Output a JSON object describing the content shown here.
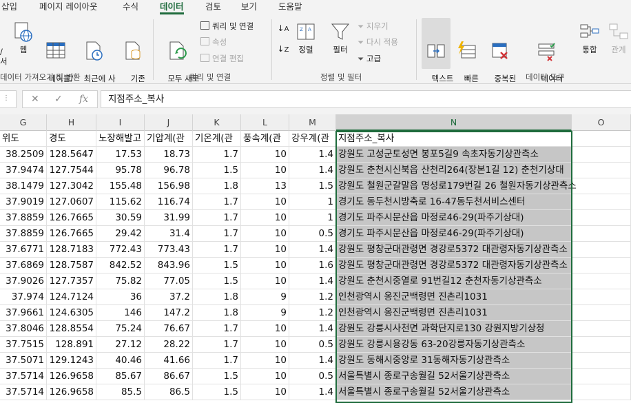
{
  "ribbon_tabs": [
    "삽입",
    "페이지 레이아웃",
    "수식",
    "데이터",
    "검토",
    "보기",
    "도움말"
  ],
  "active_tab": "데이터",
  "ribbon": {
    "get_transform": {
      "frag1": "/\n서",
      "web": "웹",
      "from_table": "테이블/\n범위에서",
      "recent_sources": "최근에 사\n용한 원본",
      "existing_conn": "기존\n연결",
      "label": "데이터 가져오기 및 변환"
    },
    "queries": {
      "refresh_all": "모두 새로\n고침 ˅",
      "queries_conn": "쿼리 및 연결",
      "properties": "속성",
      "edit_links": "연결 편집",
      "label": "쿼리 및 연결"
    },
    "sort_filter": {
      "sort": "정렬",
      "filter": "필터",
      "clear": "지우기",
      "reapply": "다시 적용",
      "advanced": "고급",
      "label": "정렬 및 필터"
    },
    "tools": {
      "text_to_columns": "텍스트\n나누기",
      "flash_fill": "빠른\n채우기",
      "remove_dup": "중복된\n항목 제거",
      "validation": "데이터\n유효성 검사 ˅",
      "consolidate": "통합",
      "relations": "관계",
      "label": "데이터 도구"
    }
  },
  "formula_bar": {
    "cancel": "✕",
    "enter": "✓",
    "fx": "fx",
    "value": "지점주소_복사"
  },
  "columns": [
    "G",
    "H",
    "I",
    "J",
    "K",
    "L",
    "M",
    "N",
    "O"
  ],
  "header_row": [
    "위도",
    "경도",
    "노장해발고",
    "기압계(관",
    "기온계(관",
    "풍속계(관",
    "강우계(관",
    "지점주소_복사",
    ""
  ],
  "rows": [
    [
      "38.2509",
      "128.5647",
      "17.53",
      "18.73",
      "1.7",
      "10",
      "1.4",
      "강원도 고성군토성면 봉포5길9 속초자동기상관측소"
    ],
    [
      "37.9474",
      "127.7544",
      "95.78",
      "96.78",
      "1.5",
      "10",
      "1.4",
      "강원도 춘천시신북읍 산천리264(장본1길 12) 춘천기상대"
    ],
    [
      "38.1479",
      "127.3042",
      "155.48",
      "156.98",
      "1.8",
      "13",
      "1.5",
      "강원도 철원군갈말읍 명성로179번길 26 철원자동기상관측소"
    ],
    [
      "37.9019",
      "127.0607",
      "115.62",
      "116.74",
      "1.7",
      "10",
      "1",
      "경기도 동두천시방축로 16-47동두천서비스센터"
    ],
    [
      "37.8859",
      "126.7665",
      "30.59",
      "31.99",
      "1.7",
      "10",
      "1",
      "경기도 파주시문산읍 마정로46-29(파주기상대)"
    ],
    [
      "37.8859",
      "126.7665",
      "29.42",
      "31.4",
      "1.7",
      "10",
      "0.5",
      "경기도 파주시문산읍 마정로46-29(파주기상대)"
    ],
    [
      "37.6771",
      "128.7183",
      "772.43",
      "773.43",
      "1.7",
      "10",
      "1.4",
      "강원도 평창군대관령면 경강로5372 대관령자동기상관측소"
    ],
    [
      "37.6869",
      "128.7587",
      "842.52",
      "843.96",
      "1.5",
      "10",
      "1.6",
      "강원도 평창군대관령면 경강로5372 대관령자동기상관측소"
    ],
    [
      "37.9026",
      "127.7357",
      "75.82",
      "77.05",
      "1.5",
      "10",
      "1.4",
      "강원도 춘천시중열로 91번길12 춘천자동기상관측소"
    ],
    [
      "37.974",
      "124.7124",
      "36",
      "37.2",
      "1.8",
      "9",
      "1.2",
      "인천광역시 옹진군백령면 진촌리1031"
    ],
    [
      "37.9661",
      "124.6305",
      "146",
      "147.2",
      "1.8",
      "9",
      "1.2",
      "인천광역시 옹진군백령면 진촌리1031"
    ],
    [
      "37.8046",
      "128.8554",
      "75.24",
      "76.67",
      "1.7",
      "10",
      "1.4",
      "강원도 강릉시사천면 과학단지로130 강원지방기상청"
    ],
    [
      "37.7515",
      "128.891",
      "27.12",
      "28.22",
      "1.7",
      "10",
      "0.5",
      "강원도 강릉시용강동 63-20강릉자동기상관측소"
    ],
    [
      "37.5071",
      "129.1243",
      "40.46",
      "41.66",
      "1.7",
      "10",
      "1.4",
      "강원도 동해시중앙로 31동해자동기상관측소"
    ],
    [
      "37.5714",
      "126.9658",
      "85.67",
      "86.67",
      "1.5",
      "10",
      "0.5",
      "서울특별시 종로구송월길 52서울기상관측소"
    ],
    [
      "37.5714",
      "126.9658",
      "85.5",
      "86.5",
      "1.5",
      "10",
      "1.4",
      "서울특별시 종로구송월길 52서울기상관측소"
    ]
  ]
}
